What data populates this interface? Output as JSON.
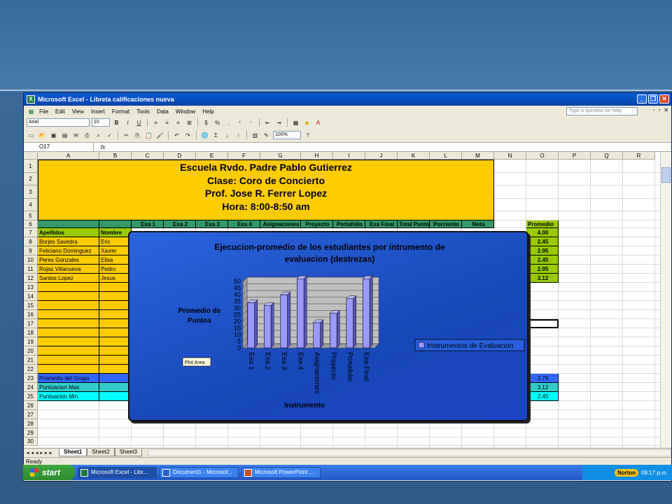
{
  "window": {
    "title": "Microsoft Excel - Libreta calificaciones nueva"
  },
  "menu": [
    "File",
    "Edit",
    "View",
    "Insert",
    "Format",
    "Tools",
    "Data",
    "Window",
    "Help"
  ],
  "help_placeholder": "Type a question for help",
  "toolbar": {
    "font": "Arial",
    "size": "10",
    "zoom": "100%"
  },
  "formula": {
    "cell_ref": "O17",
    "fx": "fx",
    "content": ""
  },
  "columns": [
    "A",
    "B",
    "C",
    "D",
    "E",
    "F",
    "G",
    "H",
    "I",
    "J",
    "K",
    "L",
    "M",
    "N",
    "O",
    "P",
    "Q",
    "R"
  ],
  "rows": [
    "1",
    "2",
    "3",
    "4",
    "5",
    "6",
    "7",
    "8",
    "9",
    "10",
    "11",
    "12",
    "13",
    "14",
    "15",
    "16",
    "17",
    "18",
    "19",
    "20",
    "21",
    "22",
    "23",
    "24",
    "25",
    "26",
    "27",
    "28",
    "29",
    "30"
  ],
  "header_lines": [
    "Escuela Rvdo. Padre Pablo Gutierrez",
    "Clase: Coro de Concierto",
    "Prof. Jose R. Ferrer Lopez",
    "Hora: 8:00-8:50 am"
  ],
  "table_headers": {
    "apellidos": "Apellidos",
    "nombre": "Nombre",
    "cols": [
      "Exa 1",
      "Exa 2",
      "Exa 3",
      "Exa 4",
      "Asignaciones",
      "Proyecto",
      "Portafolio",
      "Exa Final",
      "Total Puntos",
      "Porciento",
      "Nota"
    ],
    "promedio": "Promedio"
  },
  "students": [
    {
      "apellidos": "Borjes Savedra",
      "nombre": "Eric",
      "promedio": "2.45"
    },
    {
      "apellidos": "Feliciano Dominguez",
      "nombre": "Xavier",
      "promedio": "2.95"
    },
    {
      "apellidos": "Peres Gonzales",
      "nombre": "Elisa",
      "promedio": "2.45"
    },
    {
      "apellidos": "Rojas Villanueva",
      "nombre": "Pedro",
      "promedio": "2.95"
    },
    {
      "apellidos": "Santos Lopez",
      "nombre": "Jesus",
      "promedio": "3.12"
    }
  ],
  "promedio_row7": "4.00",
  "summary": [
    {
      "label": "Promedio del  Grupo",
      "value": "2.78"
    },
    {
      "label": "Puntuacion Max.",
      "value": "3.12"
    },
    {
      "label": "Puntuacion Min.",
      "value": "2.45"
    }
  ],
  "sheets": [
    "Sheet1",
    "Sheet2",
    "Sheet3"
  ],
  "status": "Ready",
  "plot_area_tooltip": "Plot Area",
  "chart_data": {
    "type": "bar",
    "title": "Ejecucion-promedio de los estudiantes por intrumento de evaluacion (destrezas)",
    "title_lines": [
      "Ejecucion-promedio de los estudiantes por intrumento de",
      "evaluacion (destrezas)"
    ],
    "ylabel_lines": [
      "Promedio de",
      "Puntos"
    ],
    "xlabel": "Instrumento",
    "categories": [
      "Exa 1",
      "Exa 2",
      "Exa 3",
      "Exa 4",
      "Asignaciones",
      "Proyecto",
      "Portafolio",
      "Exa Final"
    ],
    "series": [
      {
        "name": "Instrumentos de Evaluacion",
        "values": [
          34,
          32,
          40,
          52,
          19,
          26,
          37,
          52
        ]
      }
    ],
    "ylim": [
      0,
      50
    ],
    "yticks": [
      "0",
      "5",
      "10",
      "15",
      "20",
      "25",
      "30",
      "35",
      "40",
      "45",
      "50"
    ],
    "grid": true,
    "legend": "right",
    "colors": {
      "bar": "#9999ff",
      "background": "#1f4fd0",
      "plot_bg": "#c0c0c0"
    }
  },
  "taskbar": {
    "start": "start",
    "tasks": [
      "Microsoft Excel - Libr...",
      "Document1 - Microsof...",
      "Microsoft PowerPoint ..."
    ],
    "norton": "Norton",
    "clock": "09:17 p.m."
  },
  "colors": {
    "yellow": "#ffcc00",
    "green": "#339966",
    "lime": "#99cc00",
    "blue": "#3366ff",
    "cyan": "#00ffff",
    "teal": "#33cccc"
  }
}
